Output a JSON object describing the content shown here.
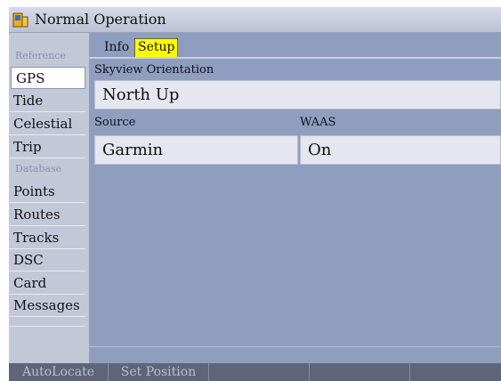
{
  "title": {
    "text": "Normal Operation",
    "icon": "gps-device-icon"
  },
  "sidebar": {
    "reference_header": "Reference",
    "reference_items": [
      {
        "label": "GPS",
        "selected": true
      },
      {
        "label": "Tide",
        "selected": false
      },
      {
        "label": "Celestial",
        "selected": false
      },
      {
        "label": "Trip",
        "selected": false
      }
    ],
    "database_header": "Database",
    "database_items": [
      {
        "label": "Points"
      },
      {
        "label": "Routes"
      },
      {
        "label": "Tracks"
      },
      {
        "label": "DSC"
      },
      {
        "label": "Card"
      },
      {
        "label": "Messages"
      }
    ]
  },
  "tabs": [
    {
      "label": "Info",
      "active": false
    },
    {
      "label": "Setup",
      "active": true
    }
  ],
  "settings": {
    "skyview_label": "Skyview Orientation",
    "skyview_value": "North Up",
    "source_label": "Source",
    "source_value": "Garmin",
    "waas_label": "WAAS",
    "waas_value": "On"
  },
  "softkeys": [
    "AutoLocate",
    "Set Position",
    "",
    "",
    ""
  ],
  "colors": {
    "accent_tab": "#ffff00",
    "panel_bg": "#8f9ebf",
    "sidebar_bg": "#c3c8d9",
    "softkey_bg": "#60647a"
  }
}
